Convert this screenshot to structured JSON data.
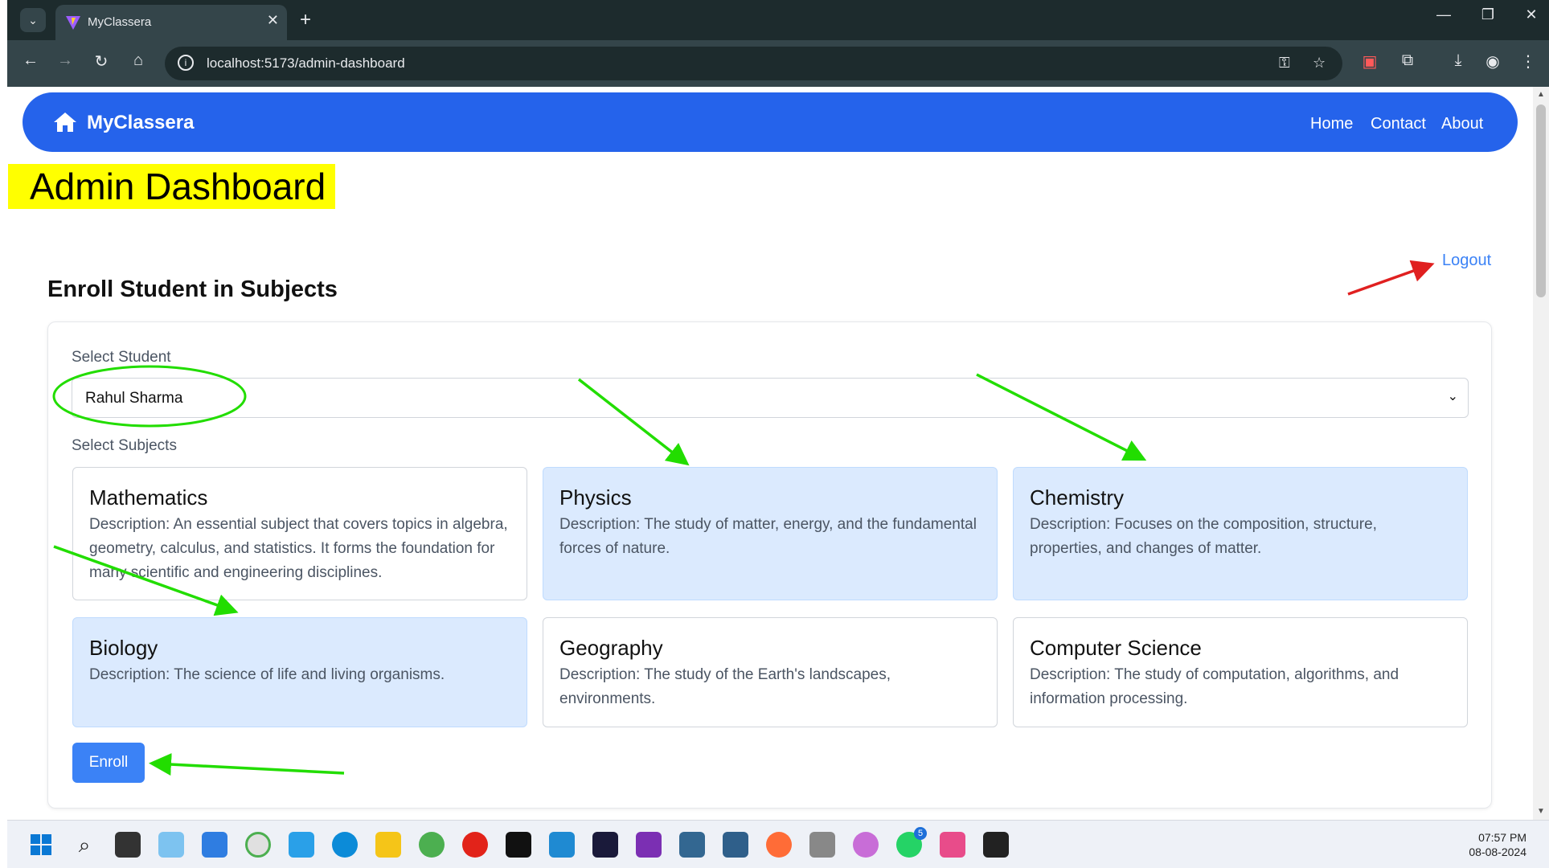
{
  "browser": {
    "tab_title": "MyClassera",
    "new_tab": "+",
    "tab_close": "✕",
    "url": "localhost:5173/admin-dashboard"
  },
  "navbar": {
    "brand": "MyClassera",
    "links": [
      "Home",
      "Contact",
      "About"
    ]
  },
  "page_title": "Admin Dashboard",
  "logout_label": "Logout",
  "section_title": "Enroll Student in Subjects",
  "form": {
    "student_label": "Select Student",
    "student_value": "Rahul Sharma",
    "subjects_label": "Select Subjects",
    "enroll_label": "Enroll"
  },
  "subjects": [
    {
      "name": "Mathematics",
      "description": "Description: An essential subject that covers topics in algebra, geometry, calculus, and statistics. It forms the foundation for many scientific and engineering disciplines.",
      "selected": false
    },
    {
      "name": "Physics",
      "description": "Description: The study of matter, energy, and the fundamental forces of nature.",
      "selected": true
    },
    {
      "name": "Chemistry",
      "description": "Description: Focuses on the composition, structure, properties, and changes of matter.",
      "selected": true
    },
    {
      "name": "Biology",
      "description": "Description: The science of life and living organisms.",
      "selected": true
    },
    {
      "name": "Geography",
      "description": "Description: The study of the Earth's landscapes, environments.",
      "selected": false
    },
    {
      "name": "Computer Science",
      "description": "Description: The study of computation, algorithms, and information processing.",
      "selected": false
    }
  ],
  "taskbar": {
    "time": "07:57 PM",
    "date": "08-08-2024",
    "whatsapp_badge": "5"
  },
  "colors": {
    "navbar": "#2563eb",
    "accent": "#3b82f6",
    "selected_card": "#dbeafe",
    "highlight": "#ffff00",
    "annotation_green": "#22dd00",
    "annotation_red": "#e02020"
  }
}
